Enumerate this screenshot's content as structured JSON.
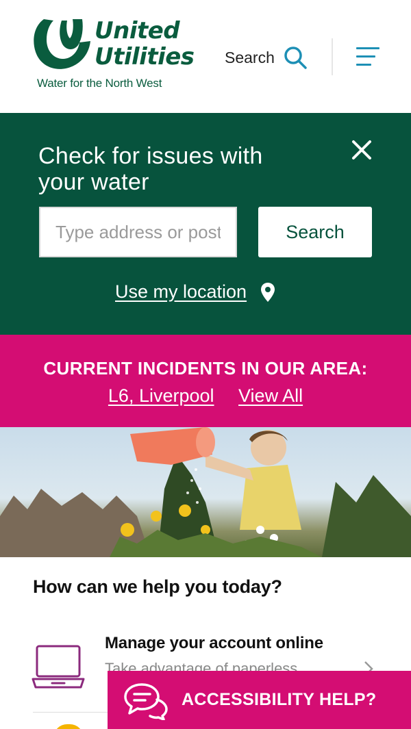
{
  "header": {
    "logo": {
      "line1": "United",
      "line2": "Utilities",
      "tagline": "Water for the North West"
    },
    "search_label": "Search",
    "icons": {
      "search": "search-icon",
      "menu": "menu-icon"
    }
  },
  "issues_panel": {
    "title": "Check for issues with your water",
    "input_placeholder": "Type address or postcode",
    "search_button": "Search",
    "location_link": "Use my location",
    "icons": {
      "close": "close-icon",
      "location": "map-pin-icon"
    }
  },
  "incidents": {
    "title": "CURRENT INCIDENTS IN OUR AREA:",
    "location_link": "L6, Liverpool",
    "view_all": "View All"
  },
  "help": {
    "title": "How can we help you today?",
    "items": [
      {
        "title": "Manage your account online",
        "subtitle": "Take advantage of paperless",
        "icon": "laptop-icon"
      }
    ]
  },
  "accessibility": {
    "label": "ACCESSIBILITY HELP?",
    "icon": "chat-bubbles-icon"
  },
  "colors": {
    "brand_green": "#07533d",
    "accent_pink": "#d40d73",
    "icon_blue": "#1d8fb5",
    "laptop_purple": "#8b2a7d"
  }
}
